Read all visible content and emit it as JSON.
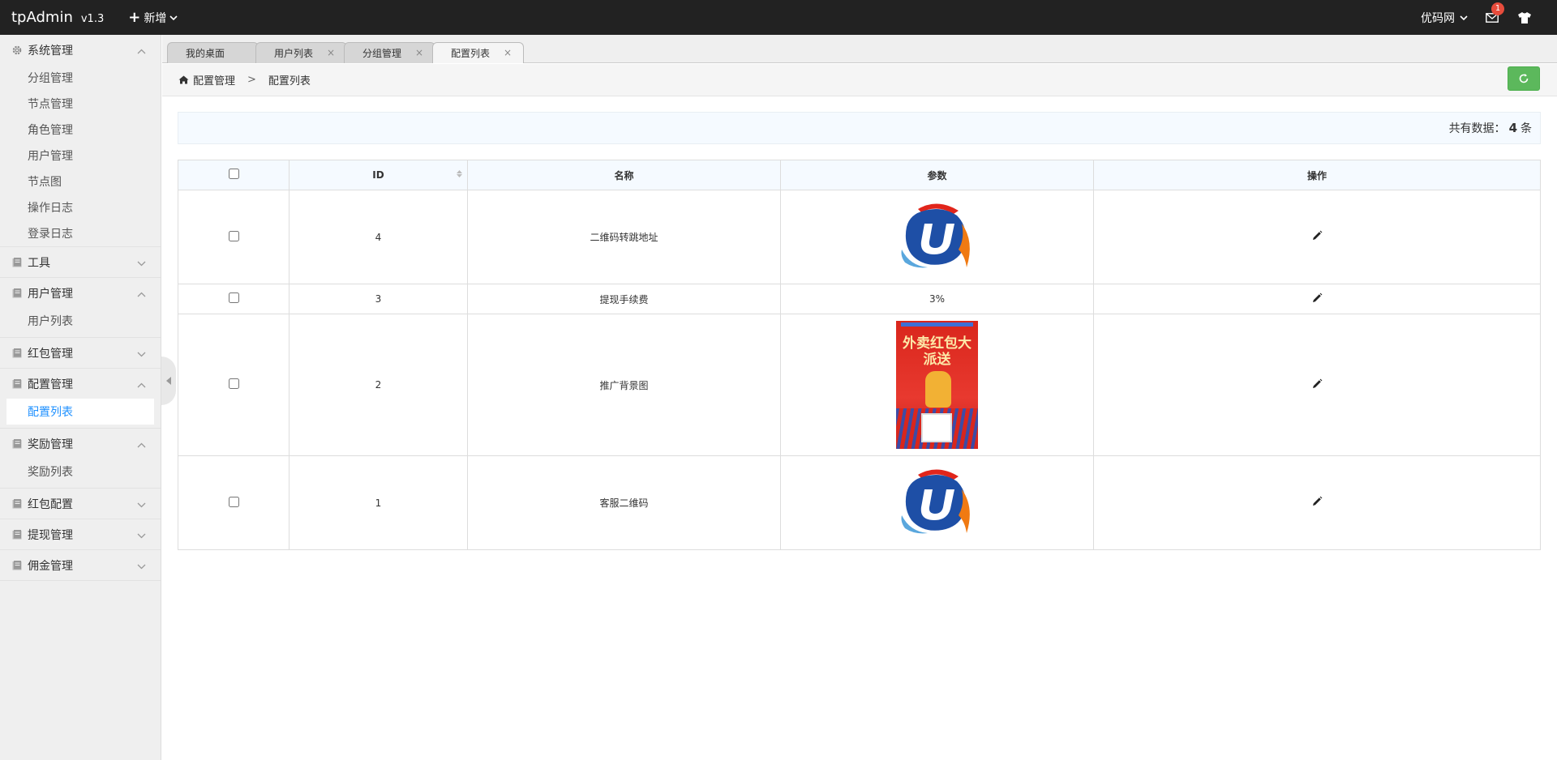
{
  "app": {
    "title": "tpAdmin",
    "version": "v1.3",
    "new_label": "新增",
    "site_label": "优码网",
    "mail_badge": "1"
  },
  "sidebar": {
    "groups": [
      {
        "label": "系统管理",
        "expanded": true,
        "items": [
          "分组管理",
          "节点管理",
          "角色管理",
          "用户管理",
          "节点图",
          "操作日志",
          "登录日志"
        ]
      },
      {
        "label": "工具",
        "expanded": false,
        "items": []
      },
      {
        "label": "用户管理",
        "expanded": true,
        "items": [
          "用户列表"
        ]
      },
      {
        "label": "红包管理",
        "expanded": false,
        "items": []
      },
      {
        "label": "配置管理",
        "expanded": true,
        "items": [
          "配置列表"
        ]
      },
      {
        "label": "奖励管理",
        "expanded": true,
        "items": [
          "奖励列表"
        ]
      },
      {
        "label": "红包配置",
        "expanded": false,
        "items": []
      },
      {
        "label": "提现管理",
        "expanded": false,
        "items": []
      },
      {
        "label": "佣金管理",
        "expanded": false,
        "items": []
      }
    ],
    "active_item": "配置列表"
  },
  "tabs": [
    {
      "label": "我的桌面",
      "closable": false
    },
    {
      "label": "用户列表",
      "closable": true
    },
    {
      "label": "分组管理",
      "closable": true
    },
    {
      "label": "配置列表",
      "closable": true,
      "active": true
    }
  ],
  "breadcrumb": {
    "parent": "配置管理",
    "current": "配置列表",
    "separator": ">"
  },
  "info": {
    "prefix": "共有数据：",
    "count": "4",
    "suffix": "条"
  },
  "table": {
    "headers": {
      "id": "ID",
      "name": "名称",
      "param": "参数",
      "action": "操作"
    },
    "rows": [
      {
        "id": "4",
        "name": "二维码转跳地址",
        "param_type": "logo",
        "param": ""
      },
      {
        "id": "3",
        "name": "提现手续费",
        "param_type": "text",
        "param": "3%"
      },
      {
        "id": "2",
        "name": "推广背景图",
        "param_type": "poster",
        "param": "",
        "poster_title": "外卖红包大派送"
      },
      {
        "id": "1",
        "name": "客服二维码",
        "param_type": "logo",
        "param": ""
      }
    ]
  },
  "colors": {
    "topbar": "#222222",
    "active_link": "#1e90ff",
    "refresh_button": "#5cb85c",
    "badge": "#e74c3c"
  }
}
